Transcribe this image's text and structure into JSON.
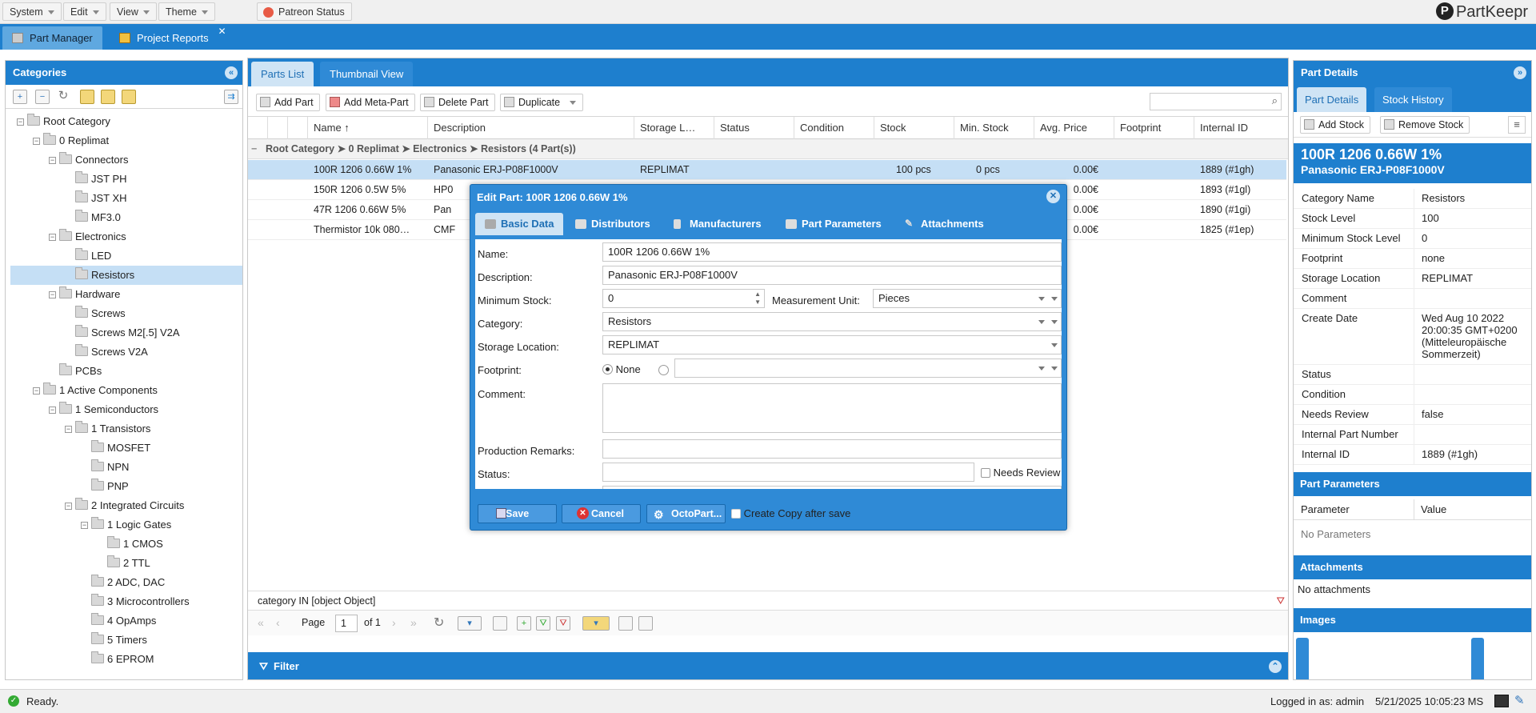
{
  "menu": {
    "items": [
      "System",
      "Edit",
      "View",
      "Theme"
    ],
    "patreon": "Patreon Status",
    "logo": "PartKeepr"
  },
  "app_tabs": [
    "Part Manager",
    "Project Reports"
  ],
  "categories": {
    "title": "Categories",
    "tree": [
      {
        "label": "Root Category",
        "depth": 0
      },
      {
        "label": "0 Replimat",
        "depth": 1
      },
      {
        "label": "Connectors",
        "depth": 2
      },
      {
        "label": "JST PH",
        "depth": 3
      },
      {
        "label": "JST XH",
        "depth": 3
      },
      {
        "label": "MF3.0",
        "depth": 3
      },
      {
        "label": "Electronics",
        "depth": 2
      },
      {
        "label": "LED",
        "depth": 3
      },
      {
        "label": "Resistors",
        "depth": 3,
        "selected": true
      },
      {
        "label": "Hardware",
        "depth": 2
      },
      {
        "label": "Screws",
        "depth": 3
      },
      {
        "label": "Screws M2[.5] V2A",
        "depth": 3
      },
      {
        "label": "Screws V2A",
        "depth": 3
      },
      {
        "label": "PCBs",
        "depth": 2
      },
      {
        "label": "1 Active Components",
        "depth": 1
      },
      {
        "label": "1 Semiconductors",
        "depth": 2
      },
      {
        "label": "1 Transistors",
        "depth": 3
      },
      {
        "label": "MOSFET",
        "depth": 4
      },
      {
        "label": "NPN",
        "depth": 4
      },
      {
        "label": "PNP",
        "depth": 4
      },
      {
        "label": "2 Integrated Circuits",
        "depth": 3
      },
      {
        "label": "1 Logic Gates",
        "depth": 4
      },
      {
        "label": "1 CMOS",
        "depth": 5
      },
      {
        "label": "2 TTL",
        "depth": 5
      },
      {
        "label": "2 ADC, DAC",
        "depth": 4
      },
      {
        "label": "3 Microcontrollers",
        "depth": 4
      },
      {
        "label": "4 OpAmps",
        "depth": 4
      },
      {
        "label": "5 Timers",
        "depth": 4
      },
      {
        "label": "6 EPROM",
        "depth": 4
      }
    ]
  },
  "center": {
    "tabs": [
      "Parts List",
      "Thumbnail View"
    ],
    "toolbar": {
      "add_part": "Add Part",
      "add_meta": "Add Meta-Part",
      "delete": "Delete Part",
      "duplicate": "Duplicate"
    },
    "columns": [
      "Name",
      "Description",
      "Storage L…",
      "Status",
      "Condition",
      "Stock",
      "Min. Stock",
      "Avg. Price",
      "Footprint",
      "Internal ID"
    ],
    "group_header": "Root Category ➤ 0 Replimat ➤ Electronics ➤ Resistors (4 Part(s))",
    "rows": [
      {
        "name": "100R 1206 0.66W 1%",
        "desc": "Panasonic ERJ-P08F1000V",
        "storage": "REPLIMAT",
        "stock": "100 pcs",
        "min": "0 pcs",
        "price": "0.00€",
        "id": "1889 (#1gh)",
        "selected": true
      },
      {
        "name": "150R 1206 0.5W 5%",
        "desc": "HP0",
        "storage": "",
        "stock": "",
        "min": "",
        "price": "0.00€",
        "id": "1893 (#1gl)"
      },
      {
        "name": "47R 1206 0.66W 5%",
        "desc": "Pan",
        "storage": "",
        "stock": "",
        "min": "",
        "price": "0.00€",
        "id": "1890 (#1gi)"
      },
      {
        "name": "Thermistor 10k 080…",
        "desc": "CMF",
        "storage": "",
        "stock": "",
        "min": "",
        "price": "0.00€",
        "id": "1825 (#1ep)"
      }
    ],
    "filter_text": "category IN [object Object]",
    "pager": {
      "page_label": "Page",
      "page": "1",
      "of": "of 1"
    },
    "filter_panel": "Filter"
  },
  "details": {
    "title": "Part Details",
    "tabs": [
      "Part Details",
      "Stock History"
    ],
    "add_stock": "Add Stock",
    "remove_stock": "Remove Stock",
    "part_name": "100R 1206 0.66W 1%",
    "part_desc": "Panasonic ERJ-P08F1000V",
    "fields": [
      {
        "k": "Category Name",
        "v": "Resistors"
      },
      {
        "k": "Stock Level",
        "v": "100"
      },
      {
        "k": "Minimum Stock Level",
        "v": "0"
      },
      {
        "k": "Footprint",
        "v": "none"
      },
      {
        "k": "Storage Location",
        "v": "REPLIMAT"
      },
      {
        "k": "Comment",
        "v": ""
      },
      {
        "k": "Create Date",
        "v": "Wed Aug 10 2022 20:00:35 GMT+0200 (Mitteleuropäische Sommerzeit)"
      },
      {
        "k": "Status",
        "v": ""
      },
      {
        "k": "Condition",
        "v": ""
      },
      {
        "k": "Needs Review",
        "v": "false"
      },
      {
        "k": "Internal Part Number",
        "v": ""
      },
      {
        "k": "Internal ID",
        "v": "1889 (#1gh)"
      }
    ],
    "params_title": "Part Parameters",
    "params_cols": [
      "Parameter",
      "Value"
    ],
    "no_params": "No Parameters",
    "attachments_title": "Attachments",
    "no_attachments": "No attachments",
    "images_title": "Images"
  },
  "dialog": {
    "title": "Edit Part: 100R 1206 0.66W 1%",
    "tabs": [
      "Basic Data",
      "Distributors",
      "Manufacturers",
      "Part Parameters",
      "Attachments"
    ],
    "labels": {
      "name": "Name:",
      "description": "Description:",
      "min_stock": "Minimum Stock:",
      "unit": "Measurement Unit:",
      "category": "Category:",
      "storage": "Storage Location:",
      "footprint": "Footprint:",
      "comment": "Comment:",
      "remarks": "Production Remarks:",
      "status": "Status:",
      "needs_review": "Needs Review",
      "none": "None"
    },
    "values": {
      "name": "100R 1206 0.66W 1%",
      "description": "Panasonic ERJ-P08F1000V",
      "min_stock": "0",
      "unit": "Pieces",
      "category": "Resistors",
      "storage": "REPLIMAT"
    },
    "buttons": {
      "save": "Save",
      "cancel": "Cancel",
      "octopart": "OctoPart...",
      "copy": "Create Copy after save"
    }
  },
  "status": {
    "ready": "Ready.",
    "user": "Logged in as: admin",
    "time": "5/21/2025 10:05:23 MS"
  },
  "colors": {
    "accent": "#1e7fce",
    "selection": "#c5dff5"
  }
}
